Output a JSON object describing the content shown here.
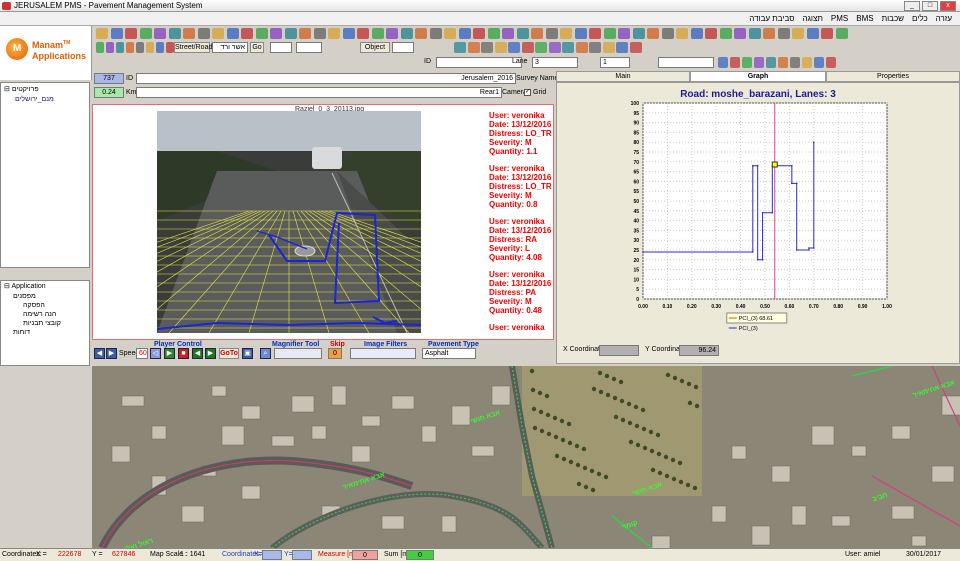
{
  "window": {
    "title": "JERUSALEM PMS - Pavement Management System"
  },
  "menu": [
    "עזרה",
    "כלים",
    "שכבות",
    "BMS",
    "PMS",
    "תצוגה",
    "סביבת עבודה"
  ],
  "logo": {
    "brand": "Manam",
    "tm": "TM",
    "sub": "Applications"
  },
  "toolbar": {
    "street_road": "Street/Road",
    "street_value": "אשר ורד",
    "go": "Go",
    "object": "Object",
    "lane_label": "Lane",
    "lane_value": "3",
    "id_label": "ID",
    "page_value": "1"
  },
  "tree_top": {
    "root": "פרויקטים",
    "child": "מנם_ירושלים"
  },
  "tree_app": {
    "root": "Application",
    "items": [
      "מפסנים",
      "הפסקה",
      "הנה רשימה",
      "קובצי תבניות",
      "דוחות"
    ]
  },
  "survey": {
    "id_value": "737",
    "id_label": "ID",
    "survey_name_value": "Jerusalem_2016",
    "survey_name_label": "Survey Name",
    "km_value": "0.24",
    "km_label": "Km",
    "camera_value": "Rear1",
    "camera_label": "Camera",
    "grid_label": "Grid"
  },
  "image": {
    "filename": "Raziel_0_3_20113.jpg"
  },
  "distress_records": [
    {
      "user": "User: veronika",
      "date": "Date: 13/12/2016",
      "distress": "Distress: LO_TR",
      "severity": "Severity: M",
      "quantity": "Quantity: 1.1"
    },
    {
      "user": "User: veronika",
      "date": "Date: 13/12/2016",
      "distress": "Distress: LO_TR",
      "severity": "Severity: M",
      "quantity": "Quantity: 0.8"
    },
    {
      "user": "User: veronika",
      "date": "Date: 13/12/2016",
      "distress": "Distress: RA",
      "severity": "Severity: L",
      "quantity": "Quantity: 4.08"
    },
    {
      "user": "User: veronika",
      "date": "Date: 13/12/2016",
      "distress": "Distress: PA",
      "severity": "Severity: M",
      "quantity": "Quantity: 0.48"
    },
    {
      "user": "User: veronika"
    }
  ],
  "player": {
    "title": "Player Control",
    "speed_label": "Speed",
    "speed_value": "60",
    "goto": "GoTo",
    "magnifier_label": "Magnifier Tool",
    "skip_label": "Skip",
    "skip_value": "0",
    "filters_label": "Image Filters",
    "pavement_label": "Pavement Type",
    "pavement_value": "Asphalt"
  },
  "tabs": [
    "Main",
    "Graph",
    "Properties"
  ],
  "graph": {
    "x_coord_label": "X Coordinate:",
    "y_coord_label": "Y Coordinate:",
    "y_coord_value": "96.24"
  },
  "chart_data": {
    "type": "line",
    "title": "Road: moshe_barazani, Lanes: 3",
    "xlabel": "",
    "ylabel": "",
    "xlim": [
      0,
      1
    ],
    "ylim": [
      0,
      100
    ],
    "xticks": [
      "0.00",
      "0.10",
      "0.20",
      "0.30",
      "0.40",
      "0.50",
      "0.60",
      "0.70",
      "0.80",
      "0.90",
      "1.00"
    ],
    "yticks": [
      "0",
      "5",
      "10",
      "15",
      "20",
      "25",
      "30",
      "35",
      "40",
      "45",
      "50",
      "55",
      "60",
      "65",
      "70",
      "75",
      "80",
      "85",
      "90",
      "95",
      "100"
    ],
    "grid": true,
    "series": [
      {
        "name": "PCI_(3)",
        "x": [
          0.0,
          0.45,
          0.45,
          0.47,
          0.47,
          0.49,
          0.49,
          0.53,
          0.53,
          0.61,
          0.61,
          0.63,
          0.63,
          0.68,
          0.68,
          0.7,
          0.7
        ],
        "y": [
          24,
          24,
          68,
          68,
          20,
          20,
          44,
          44,
          68,
          68,
          59,
          59,
          25,
          25,
          26,
          26,
          80
        ],
        "step": true
      }
    ],
    "cursor_x": 0.54,
    "tooltip": {
      "text": "PCI_(3) 68.61",
      "x": 0.54,
      "y": 68.61
    },
    "legend": [
      "PCI_(3)"
    ],
    "legend_position": "bottom"
  },
  "map_labels": [
    "ראול ואלנברג",
    "אבא אחימאיר",
    "אבא חושי",
    "קומוי",
    "אבא חושי",
    "חביב",
    "אבא אחימאיר"
  ],
  "statusbar": {
    "coords_label": "Coordinates:",
    "x_label": "X =",
    "x_value": "222678",
    "y_label": "Y =",
    "y_value": "627846",
    "scale_label": "Map Scale :",
    "scale_value": "1 : 1641",
    "coords2_label": "Coordinates:",
    "x2_label": "X=",
    "y2_label": "Y=",
    "measure_label": "Measure [m]:",
    "measure_value": "0",
    "sum_label": "Sum [m]:",
    "sum_value": "0",
    "user": "User: amiel",
    "date": "30/01/2017"
  },
  "colors": {
    "distress_red": "#e00000",
    "overlay_blue": "#1a24d8",
    "grid_yellow": "#e8e840",
    "series_blue": "#2a2ad0",
    "cursor_pink": "#e0408a",
    "title_blue": "#1a1aa0"
  }
}
